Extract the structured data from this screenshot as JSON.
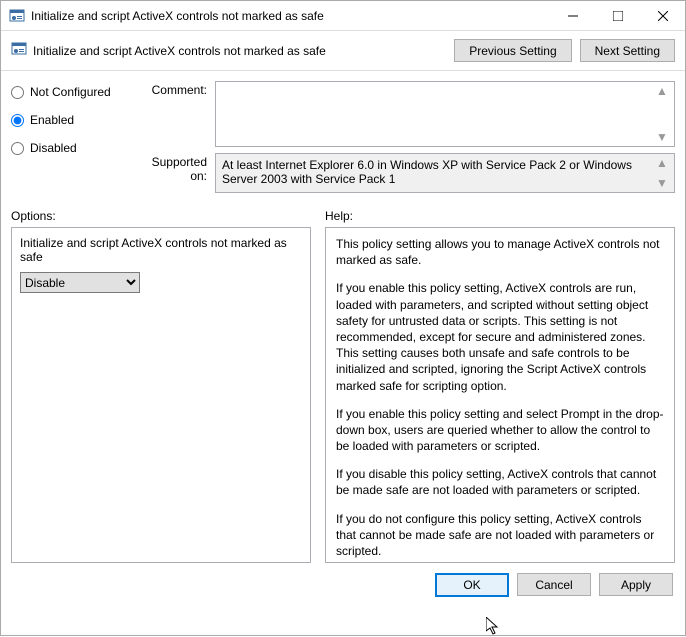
{
  "window": {
    "title": "Initialize and script ActiveX controls not marked as safe"
  },
  "subheader": {
    "title": "Initialize and script ActiveX controls not marked as safe",
    "prev": "Previous Setting",
    "next": "Next Setting"
  },
  "radios": {
    "not_configured": "Not Configured",
    "enabled": "Enabled",
    "disabled": "Disabled",
    "selected": "enabled"
  },
  "fields": {
    "comment_label": "Comment:",
    "comment_value": "",
    "supported_label": "Supported on:",
    "supported_value": "At least Internet Explorer 6.0 in Windows XP with Service Pack 2 or Windows Server 2003 with Service Pack 1"
  },
  "panes": {
    "options_label": "Options:",
    "help_label": "Help:"
  },
  "options": {
    "setting_name": "Initialize and script ActiveX controls not marked as safe",
    "dropdown_value": "Disable"
  },
  "help": {
    "p1": "This policy setting allows you to manage ActiveX controls not marked as safe.",
    "p2": "If you enable this policy setting, ActiveX controls are run, loaded with parameters, and scripted without setting object safety for untrusted data or scripts. This setting is not recommended, except for secure and administered zones. This setting causes both unsafe and safe controls to be initialized and scripted, ignoring the Script ActiveX controls marked safe for scripting option.",
    "p3": "If you enable this policy setting and select Prompt in the drop-down box, users are queried whether to allow the control to be loaded with parameters or scripted.",
    "p4": "If you disable this policy setting, ActiveX controls that cannot be made safe are not loaded with parameters or scripted.",
    "p5": "If you do not configure this policy setting, ActiveX controls that cannot be made safe are not loaded with parameters or scripted."
  },
  "footer": {
    "ok": "OK",
    "cancel": "Cancel",
    "apply": "Apply"
  }
}
